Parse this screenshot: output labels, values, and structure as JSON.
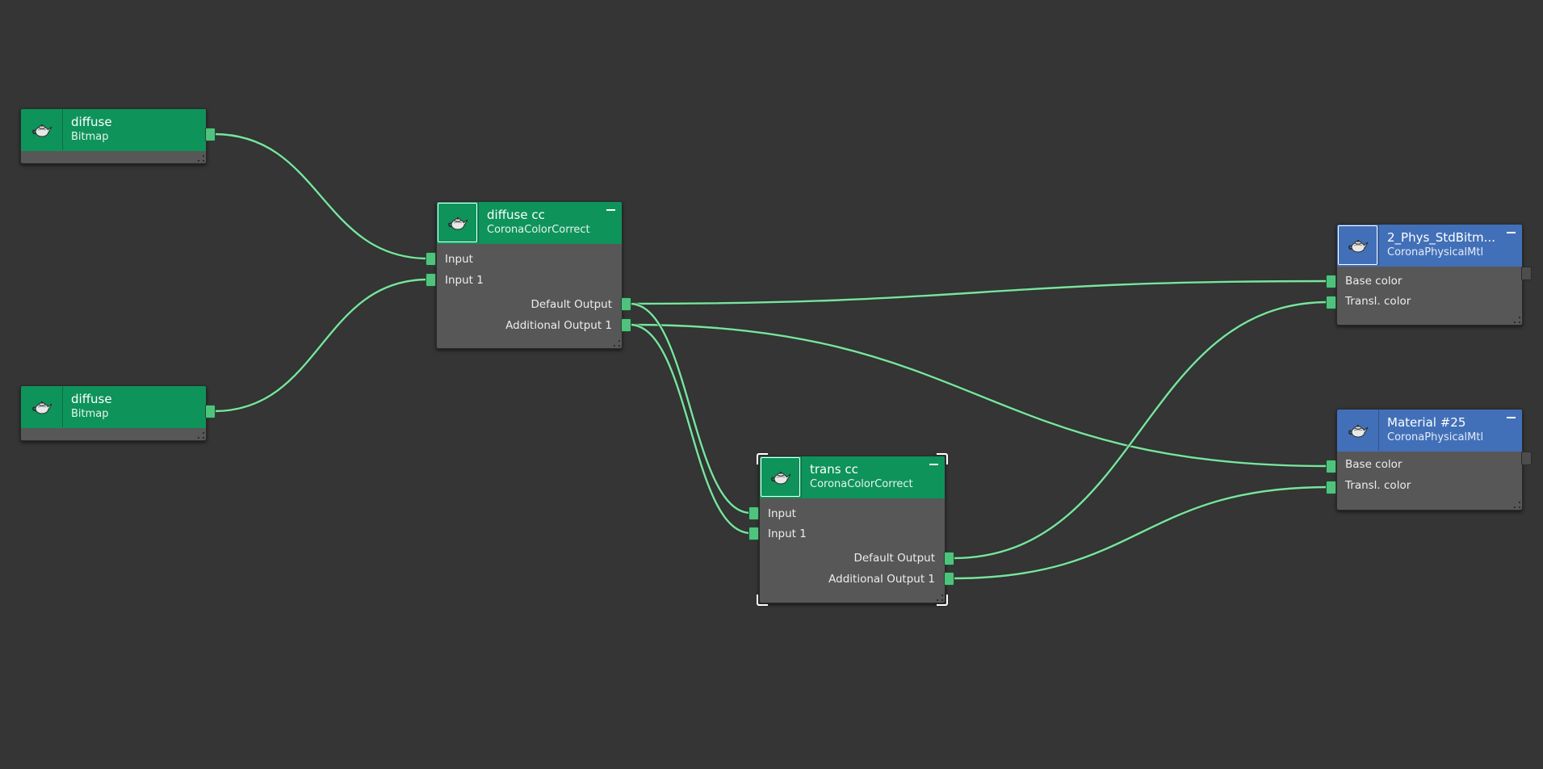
{
  "editor": {
    "nodes": {
      "diffuse1": {
        "title": "diffuse",
        "type": "Bitmap",
        "icon": "teapot-icon",
        "color": "#0e935b"
      },
      "diffuse2": {
        "title": "diffuse",
        "type": "Bitmap",
        "icon": "teapot-icon",
        "color": "#0e935b"
      },
      "diffuse_cc": {
        "title": "diffuse cc",
        "type": "CoronaColorCorrect",
        "icon": "teapot-icon",
        "color": "#0e935b",
        "inputs": [
          "Input",
          "Input 1"
        ],
        "outputs": [
          "Default Output",
          "Additional Output 1"
        ]
      },
      "trans_cc": {
        "title": "trans cc",
        "type": "CoronaColorCorrect",
        "icon": "teapot-icon",
        "color": "#0e935b",
        "inputs": [
          "Input",
          "Input 1"
        ],
        "outputs": [
          "Default Output",
          "Additional Output 1"
        ]
      },
      "phys_std": {
        "title": "2_Phys_StdBitm...",
        "type": "CoronaPhysicalMtl",
        "icon": "teapot-icon",
        "color": "#4270b8",
        "inputs": [
          "Base color",
          "Transl. color"
        ]
      },
      "material25": {
        "title": "Material #25",
        "type": "CoronaPhysicalMtl",
        "icon": "teapot-icon",
        "color": "#4270b8",
        "inputs": [
          "Base color",
          "Transl. color"
        ]
      }
    },
    "wire_color": "#7ee0a0",
    "port_color": "#4fc37d",
    "background_color": "#353535"
  }
}
